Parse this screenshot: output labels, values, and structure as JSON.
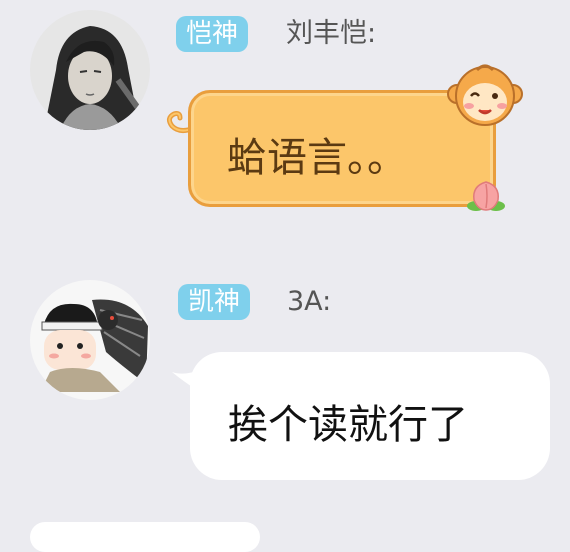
{
  "messages": [
    {
      "badge": "恺神",
      "sender": "刘丰恺:",
      "text": "蛤语言。。",
      "bubble_style": "monkey-orange",
      "avatar": "avatar-long-hair-swordsman"
    },
    {
      "badge": "凯神",
      "sender": "3A:",
      "text": "挨个读就行了",
      "bubble_style": "white",
      "avatar": "avatar-chibi-boy-with-crow"
    }
  ],
  "colors": {
    "background": "#ebebf0",
    "badge": "#7fd0ec",
    "orange_bubble": "#fcc66a",
    "orange_border": "#e99e3d",
    "white_bubble": "#ffffff"
  }
}
